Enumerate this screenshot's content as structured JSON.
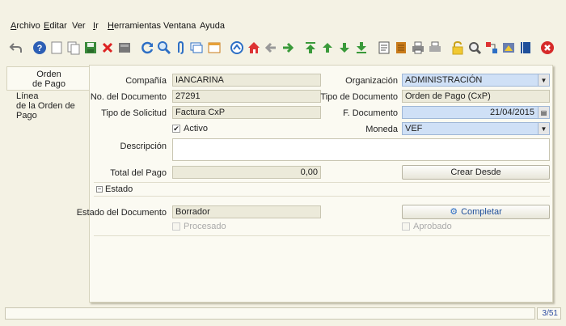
{
  "menu": {
    "archivo": {
      "first": "A",
      "rest": "rchivo"
    },
    "editar": {
      "first": "E",
      "rest": "ditar"
    },
    "ver": {
      "first": "",
      "rest": "Ver"
    },
    "ir": {
      "first": "I",
      "rest": "r"
    },
    "herramientas": {
      "first": "H",
      "rest": "erramientas"
    },
    "ventana": {
      "first": "",
      "rest": "Ventana"
    },
    "ayuda": {
      "first": "",
      "rest": "Ayuda"
    }
  },
  "toolbar_icons": [
    "undo-icon",
    "help-icon",
    "new-icon",
    "copy-icon",
    "save-icon",
    "delete-icon",
    "print-preview-icon",
    "refresh-icon",
    "find-icon",
    "attachment-icon",
    "chat-icon",
    "history-icon",
    "home-icon",
    "parent-icon",
    "back-icon",
    "forward-icon",
    "first-icon",
    "up-icon",
    "down-icon",
    "last-icon",
    "report-icon",
    "archive-icon",
    "print-icon",
    "print-alt-icon",
    "lock-icon",
    "zoom-icon",
    "workflow-icon",
    "process-icon",
    "book-icon",
    "close-icon"
  ],
  "tabs": {
    "active": {
      "line1": "Orden",
      "line2": "de Pago"
    },
    "inactive": {
      "line1": "Línea",
      "line2": "de la Orden de Pago"
    }
  },
  "form": {
    "compania_label": "Compañía",
    "compania_value": "IANCARINA",
    "organizacion_label": "Organización",
    "organizacion_value": "ADMINISTRACIÓN",
    "no_documento_label": "No. del Documento",
    "no_documento_value": "27291",
    "tipo_documento_label": "Tipo de Documento",
    "tipo_documento_value": "Orden de Pago (CxP)",
    "tipo_solicitud_label": "Tipo de Solicitud",
    "tipo_solicitud_value": "Factura CxP",
    "f_documento_label": "F. Documento",
    "f_documento_value": "21/04/2015",
    "activo_label": "Activo",
    "moneda_label": "Moneda",
    "moneda_value": "VEF",
    "descripcion_label": "Descripción",
    "descripcion_value": "",
    "total_pago_label": "Total del Pago",
    "total_pago_value": "0,00",
    "crear_desde_label": "Crear Desde"
  },
  "estado": {
    "section_label": "Estado",
    "estado_documento_label": "Estado del Documento",
    "estado_documento_value": "Borrador",
    "completar_label": "Completar",
    "procesado_label": "Procesado",
    "aprobado_label": "Aprobado"
  },
  "status": {
    "message": "",
    "record_count": "3/51"
  },
  "colors": {
    "background": "#f4f2e4",
    "panel": "#fbfaf2",
    "readonly_field": "#eceada",
    "mandatory_field": "#cfe0f6",
    "record_count_text": "#2b4aa0"
  }
}
